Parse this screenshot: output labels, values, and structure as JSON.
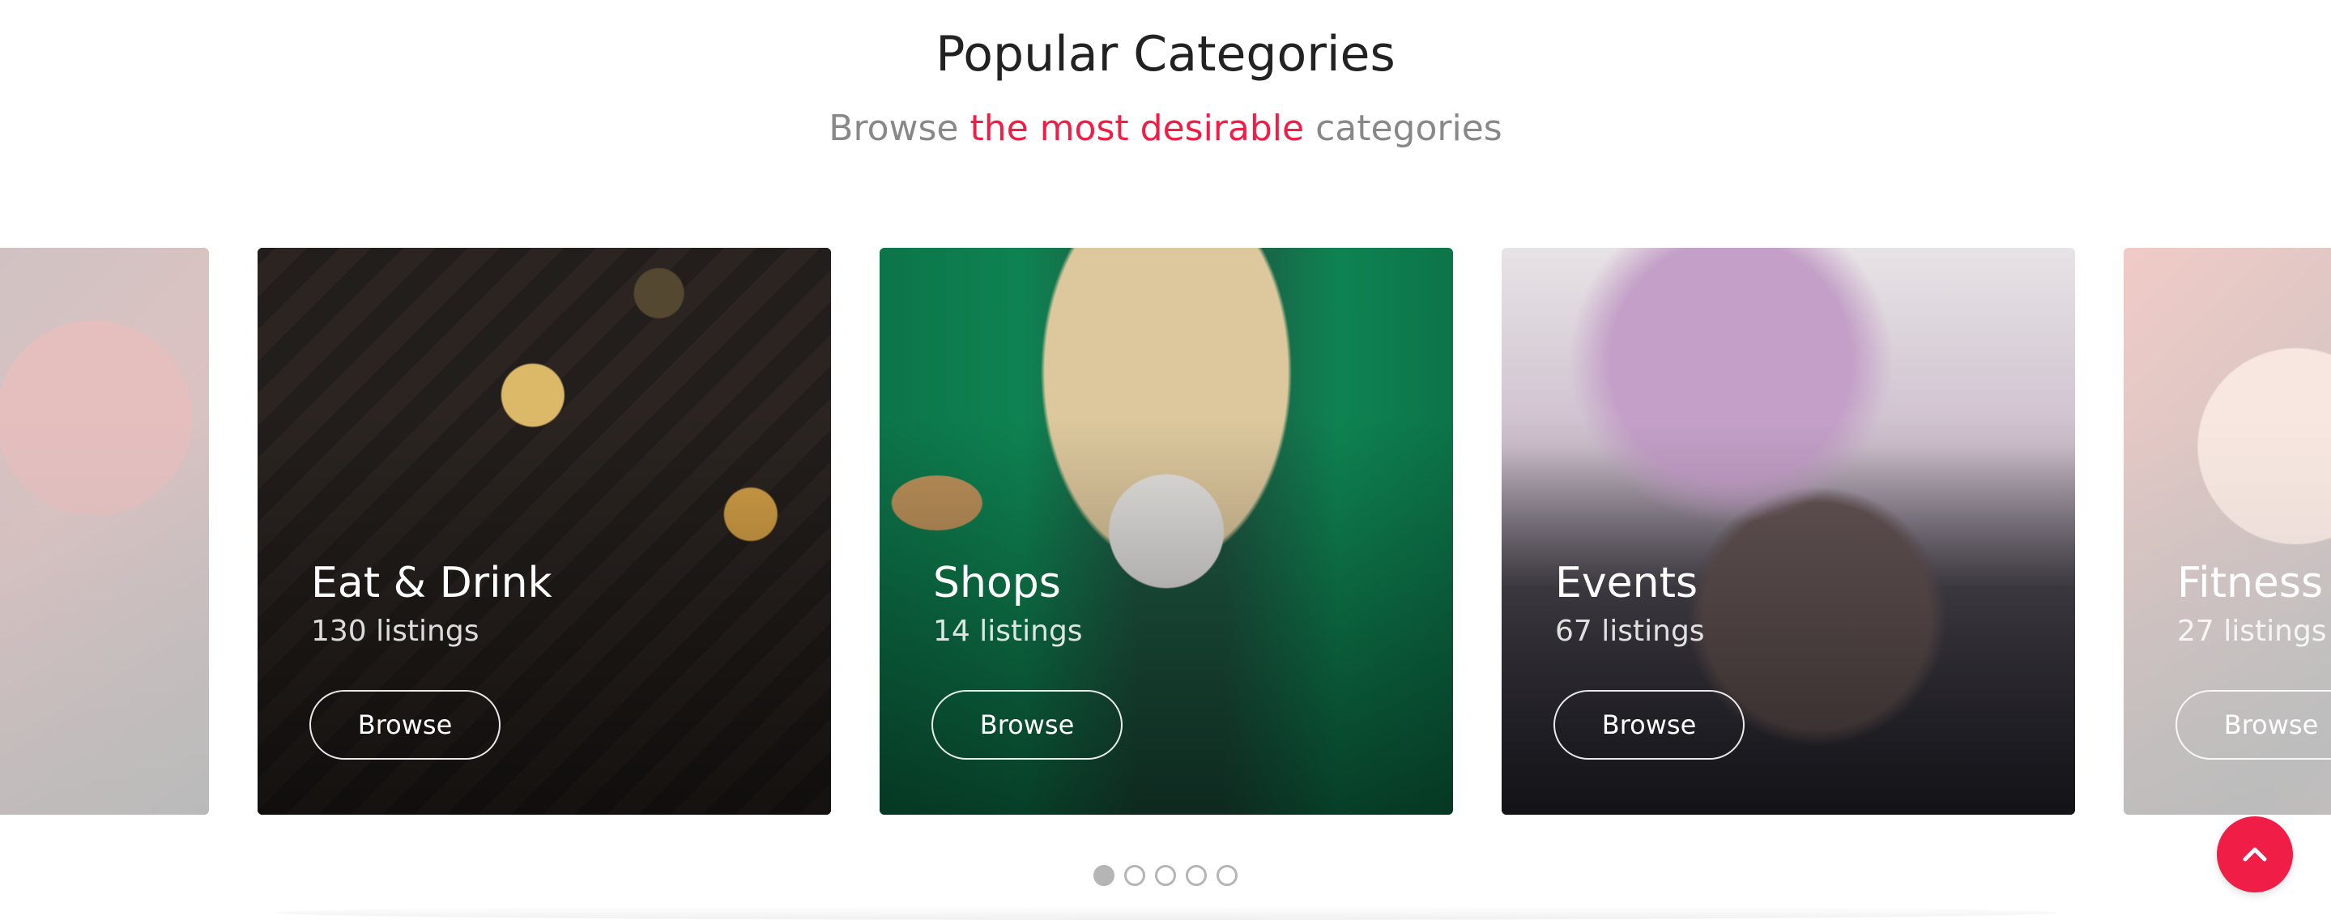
{
  "section": {
    "title": "Popular Categories",
    "subtitle": {
      "prefix": "Browse",
      "highlight": "the most desirable",
      "suffix": "categories"
    }
  },
  "cards": [
    {
      "name": "",
      "count": "",
      "browse_label": "",
      "faded": true
    },
    {
      "name": "Eat & Drink",
      "count": "130 listings",
      "browse_label": "Browse",
      "faded": false
    },
    {
      "name": "Shops",
      "count": "14 listings",
      "browse_label": "Browse",
      "faded": false
    },
    {
      "name": "Events",
      "count": "67 listings",
      "browse_label": "Browse",
      "faded": false
    },
    {
      "name": "Fitness",
      "count": "27 listings",
      "browse_label": "Browse",
      "faded": true
    }
  ],
  "carousel": {
    "dot_count": 5,
    "active_index": 0
  },
  "colors": {
    "accent": "#f01e46",
    "title": "#222222",
    "subtitle": "#888888",
    "dot": "#b5b5b5"
  },
  "icons": {
    "scroll_top": "chevron-up-icon"
  }
}
